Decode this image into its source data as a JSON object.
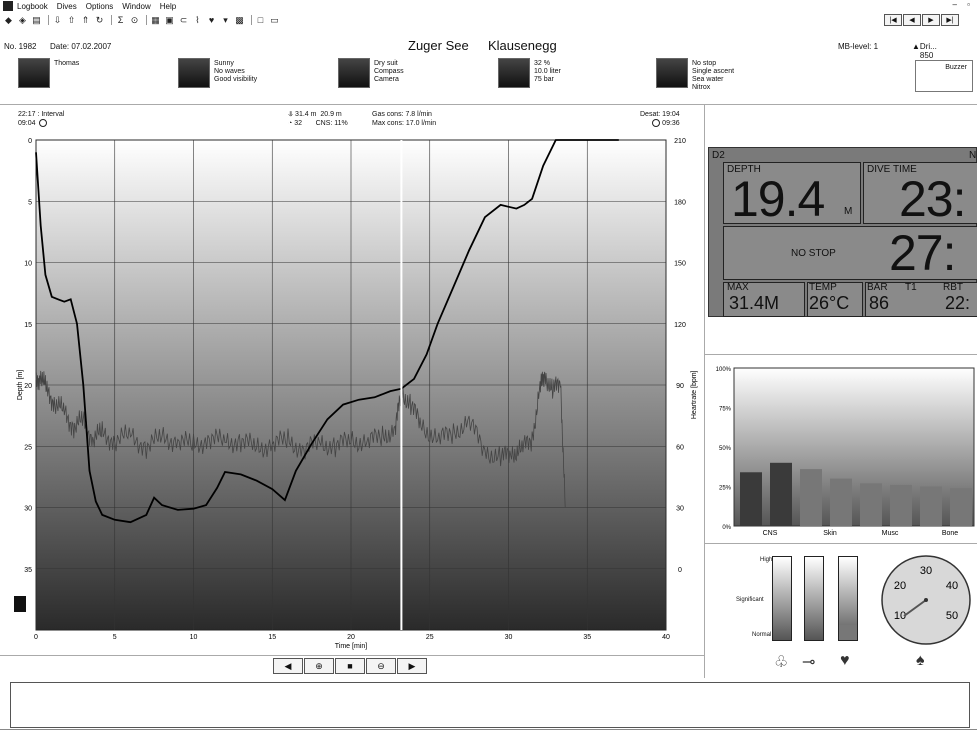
{
  "menubar": {
    "items": [
      "Logbook",
      "Dives",
      "Options",
      "Window",
      "Help"
    ],
    "window_controls": "– ▫"
  },
  "toolbar": {
    "icons": [
      "dive-icon",
      "layers-icon",
      "print-icon",
      "import-icon",
      "export-icon",
      "upload-icon",
      "refresh-icon",
      "sum-icon",
      "compass-icon",
      "grid-icon",
      "calendar-icon",
      "tank-icon",
      "thermometer-icon",
      "heart-icon",
      "filter-icon",
      "photo-icon",
      "window-a-icon",
      "window-b-icon"
    ],
    "glyphs": [
      "◆",
      "◈",
      "▤",
      "⇩",
      "⇧",
      "⇑",
      "↻",
      "Σ",
      "⊙",
      "▦",
      "▣",
      "⊂",
      "⌇",
      "♥",
      "▾",
      "▩",
      "□",
      "▭"
    ]
  },
  "nav": {
    "first": "|◀",
    "prev": "◀",
    "next": "▶",
    "last": "▶|"
  },
  "dive": {
    "number_label": "No. 1982",
    "date_label": "Date: 07.02.2007",
    "lake": "Zuger See",
    "site": "Klausenegg",
    "mb_level": "MB-level: 1",
    "profile_right": "Dri... 850"
  },
  "strip": [
    {
      "lines": [
        "Thomas"
      ]
    },
    {
      "lines": [
        "Sunny",
        "No waves",
        "Good visibility"
      ]
    },
    {
      "lines": [
        "Dry suit",
        "Compass",
        "Camera"
      ]
    },
    {
      "lines": [
        "32 %",
        "10.0 liter",
        "75 bar"
      ]
    },
    {
      "lines": [
        "No stop",
        "Single ascent",
        "Sea water",
        "Nitrox"
      ]
    }
  ],
  "buzzer_label": "Buzzer",
  "stats": {
    "interval": "22:17 : Interval",
    "start_time": "09:04",
    "max_depth": "31.4 m",
    "avg_depth": "20.9 m",
    "dive_time": "32",
    "cns": "CNS: 11%",
    "gas_cons": "Gas cons: 7.8 l/min",
    "max_cons": "Max cons: 17.0 l/min",
    "desat": "Desat: 19:04",
    "end_time": "09:36"
  },
  "chart_data": {
    "type": "line",
    "xlabel": "Time [min]",
    "ylabel": "Depth [m]",
    "y2label": "Heartrate [bpm]",
    "xlim": [
      0,
      40
    ],
    "ylim": [
      0,
      40
    ],
    "y2lim": [
      -30,
      210
    ],
    "x_ticks": [
      0,
      5,
      10,
      15,
      20,
      25,
      30,
      35,
      40
    ],
    "y_ticks": [
      0,
      5,
      10,
      15,
      20,
      25,
      30,
      35
    ],
    "y2_ticks": [
      210,
      180,
      150,
      120,
      90,
      60,
      30,
      0
    ],
    "cursor_x": 23.2,
    "series": [
      {
        "x": [
          0,
          0.3,
          0.6,
          1,
          1.4,
          1.8,
          2.2,
          2.6,
          3.0,
          3.4,
          3.8,
          4.2,
          5,
          6,
          7,
          7.5,
          8,
          9,
          10,
          10.8,
          11.5,
          12,
          13,
          14,
          15,
          15.8,
          16.5,
          17.5,
          18.5,
          19.5,
          20.5,
          21.5,
          22.5,
          23.2,
          24,
          24.8,
          25.5,
          26.5,
          27.5,
          28.5,
          29.5,
          30.5,
          31,
          31.5,
          32.2,
          33,
          34,
          35,
          36,
          37
        ],
        "y": [
          1,
          7,
          11,
          12.8,
          13,
          13.2,
          13,
          15,
          20,
          27,
          29.5,
          30.6,
          31,
          31.2,
          30.6,
          29.2,
          29.8,
          30.2,
          30.1,
          29.8,
          28.4,
          27.1,
          27.3,
          27.8,
          28.5,
          29.4,
          27,
          24.8,
          22.8,
          21.6,
          21.2,
          21,
          20.5,
          20.3,
          19.5,
          17.5,
          15,
          12,
          9,
          6.3,
          5.3,
          5.6,
          5.3,
          4.8,
          2.1,
          0,
          0,
          0,
          0,
          0
        ]
      },
      {
        "name": "Heartrate",
        "x": [
          0,
          0.3,
          0.7,
          1.2,
          1.8,
          2.4,
          3.0,
          3.6,
          4.2,
          5,
          6,
          7,
          8,
          9,
          10,
          11,
          12,
          13,
          14,
          15,
          16,
          17,
          18,
          19,
          20,
          21,
          22,
          22.8,
          23.2,
          23.8,
          24.5,
          25.5,
          26.5,
          27.5,
          28.5,
          29.5,
          30.2,
          30.8,
          31.5,
          32.0,
          32.3,
          32.8,
          33.3,
          33.6
        ],
        "y": [
          90,
          96,
          86,
          82,
          76,
          70,
          72,
          64,
          66,
          63,
          65,
          60,
          64,
          63,
          60,
          64,
          62,
          63,
          59,
          61,
          63,
          58,
          62,
          60,
          63,
          62,
          65,
          68,
          87,
          80,
          70,
          63,
          67,
          72,
          58,
          54,
          57,
          58,
          64,
          88,
          96,
          86,
          93,
          30
        ]
      }
    ]
  },
  "computer": {
    "brand": "D2",
    "corner": "N",
    "depth_label": "DEPTH",
    "depth_value": "19.4",
    "depth_unit": "M",
    "dive_time_label": "DIVE TIME",
    "dive_time_value": "23:",
    "no_stop_label": "NO STOP",
    "no_stop_value": "27:",
    "max_label": "MAX",
    "max_value": "31.4M",
    "temp_label": "TEMP",
    "temp_value": "26°C",
    "bar_label": "BAR",
    "t1_label": "T1",
    "bar_value": "86",
    "rbt_label": "RBT",
    "rbt_value": "22:"
  },
  "tissue_chart": {
    "type": "bar",
    "categories": [
      "CNS",
      "Skin",
      "Musc",
      "Bone"
    ],
    "y_ticks": [
      "100%",
      "75%",
      "50%",
      "25%",
      "0%"
    ],
    "values": [
      34,
      40,
      36,
      30,
      27,
      26,
      25,
      24
    ]
  },
  "gauges": {
    "levels": [
      "High",
      "Significant",
      "Normal"
    ],
    "fill_levels": [
      0,
      0,
      0.18
    ],
    "dial_ticks": [
      "10",
      "20",
      "30",
      "40",
      "50"
    ],
    "icons": [
      "lungs-stress-icon",
      "thermometer-icon",
      "heart-icon",
      "lungs-icon"
    ]
  }
}
